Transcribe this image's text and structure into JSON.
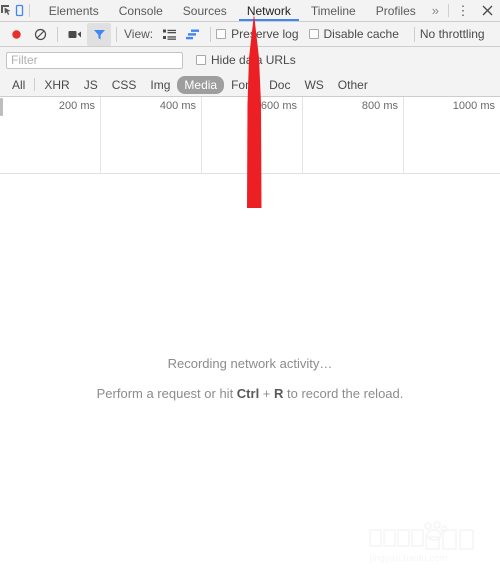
{
  "tabbar": {
    "inspect_icon": "inspect-element-icon",
    "device_icon": "device-toolbar-icon",
    "tabs": [
      {
        "label": "Elements",
        "active": false
      },
      {
        "label": "Console",
        "active": false
      },
      {
        "label": "Sources",
        "active": false
      },
      {
        "label": "Network",
        "active": true
      },
      {
        "label": "Timeline",
        "active": false
      },
      {
        "label": "Profiles",
        "active": false
      }
    ],
    "overflow": "»",
    "menu": "⋮",
    "close": "×",
    "accent_color": "#4286f4"
  },
  "toolbar": {
    "record_label": "Record",
    "clear_label": "Clear",
    "capture_screenshots_label": "Capture screenshots",
    "filter_label": "Filter",
    "view_label": "View:",
    "view_list_label": "Use large request rows",
    "view_waterfall_label": "Show overview",
    "preserve_log": {
      "label": "Preserve log",
      "checked": false
    },
    "disable_cache": {
      "label": "Disable cache",
      "checked": false
    },
    "throttling": "No throttling",
    "record_color": "#e8302b",
    "active_icon_color": "#4286f4"
  },
  "filterbar": {
    "input_value": "",
    "placeholder": "Filter",
    "hide_data_urls": {
      "label": "Hide data URLs",
      "checked": false
    }
  },
  "types": {
    "items": [
      {
        "label": "All",
        "selected": false
      },
      {
        "label": "XHR",
        "selected": false
      },
      {
        "label": "JS",
        "selected": false
      },
      {
        "label": "CSS",
        "selected": false
      },
      {
        "label": "Img",
        "selected": false
      },
      {
        "label": "Media",
        "selected": true
      },
      {
        "label": "Font",
        "selected": false
      },
      {
        "label": "Doc",
        "selected": false
      },
      {
        "label": "WS",
        "selected": false
      },
      {
        "label": "Other",
        "selected": false
      }
    ],
    "selected_bg": "#9e9e9e"
  },
  "timeline": {
    "ticks": [
      "200 ms",
      "400 ms",
      "600 ms",
      "800 ms",
      "1000 ms"
    ]
  },
  "empty_state": {
    "line1": "Recording network activity…",
    "line2_prefix": "Perform a request or hit ",
    "key1": "Ctrl",
    "plus": " + ",
    "key2": "R",
    "line2_suffix": " to record the reload."
  },
  "annotation": {
    "arrow_name": "red-up-arrow-pointing-to-network-tab",
    "color": "#ec1f25"
  },
  "watermark": {
    "brand": "Baidu",
    "brand_cn": "经验",
    "url": "jingyan.baidu.com"
  }
}
